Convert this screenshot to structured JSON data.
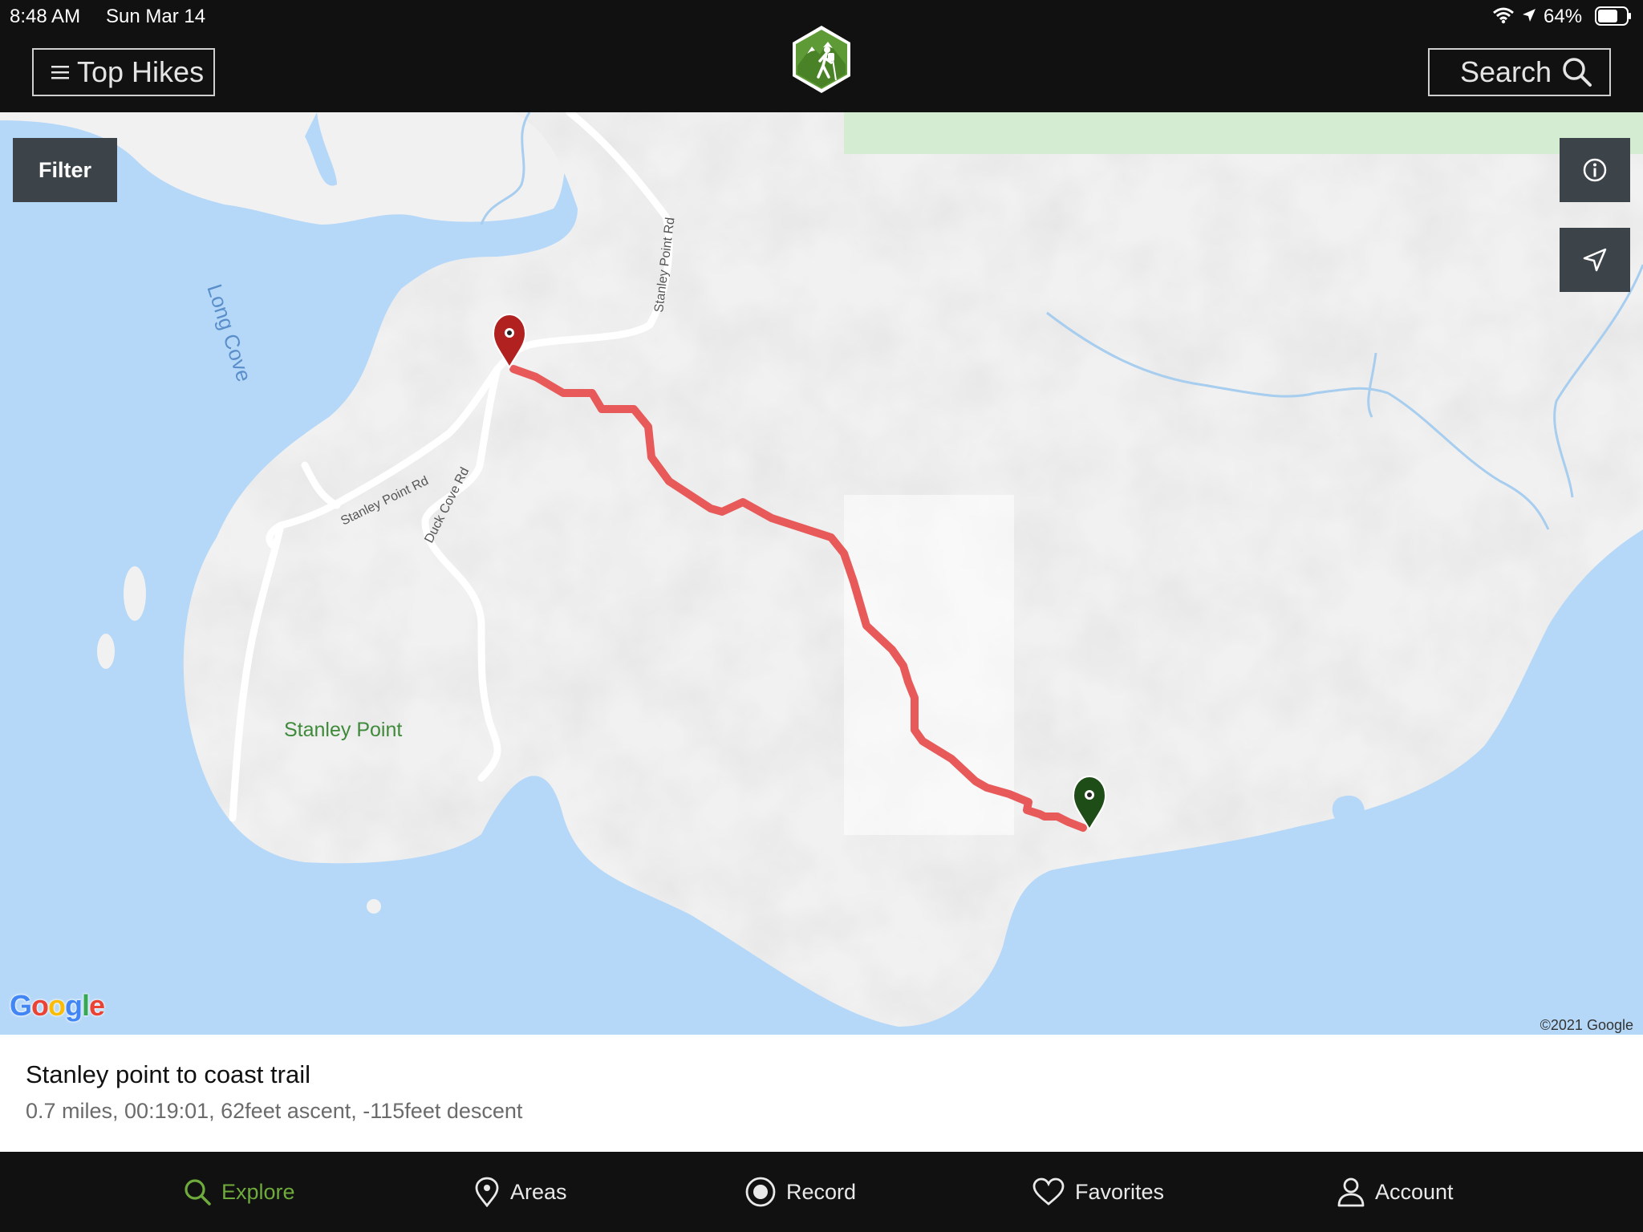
{
  "status_bar": {
    "time": "8:48 AM",
    "date": "Sun Mar 14",
    "battery": "64%"
  },
  "header": {
    "menu_label": "Top Hikes",
    "search_label": "Search",
    "logo_icon": "hiker-badge-icon"
  },
  "map": {
    "filter_label": "Filter",
    "labels": {
      "long_cove": "Long Cove",
      "stanley_point_rd_1": "Stanley Point Rd",
      "stanley_point_rd_2": "Stanley Point Rd",
      "duck_cove_rd": "Duck Cove Rd",
      "stanley_point": "Stanley Point"
    },
    "attribution_logo": "Google",
    "copyright": "©2021 Google",
    "route_color": "#e85a5a",
    "start_marker_color": "#b0211f",
    "end_marker_color": "#1e4d17"
  },
  "trail": {
    "title": "Stanley point to coast trail",
    "stats": "0.7 miles, 00:19:01, 62feet ascent, -115feet descent"
  },
  "tabs": [
    {
      "label": "Explore",
      "icon": "search-icon",
      "active": true
    },
    {
      "label": "Areas",
      "icon": "map-pin-icon",
      "active": false
    },
    {
      "label": "Record",
      "icon": "record-icon",
      "active": false
    },
    {
      "label": "Favorites",
      "icon": "heart-icon",
      "active": false
    },
    {
      "label": "Account",
      "icon": "person-icon",
      "active": false
    }
  ],
  "colors": {
    "accent": "#6eaa3c",
    "bar": "#111111",
    "water": "#b6d8f8",
    "land": "#f1f1f1"
  }
}
